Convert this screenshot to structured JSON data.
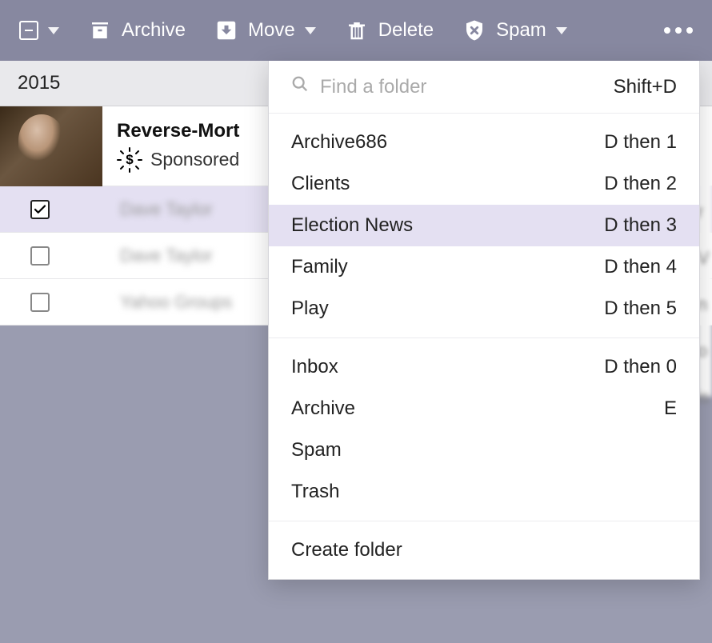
{
  "toolbar": {
    "archive_label": "Archive",
    "move_label": "Move",
    "delete_label": "Delete",
    "spam_label": "Spam"
  },
  "date_header": "2015",
  "sponsored": {
    "title": "Reverse-Mort",
    "label": "Sponsored"
  },
  "emails": [
    {
      "sender": "Dave Taylor",
      "checked": true
    },
    {
      "sender": "Dave Taylor",
      "checked": false
    },
    {
      "sender": "Yahoo Groups",
      "checked": false
    }
  ],
  "dropdown": {
    "search_placeholder": "Find a folder",
    "search_shortcut": "Shift+D",
    "folders": [
      {
        "name": "Archive686",
        "shortcut": "D then 1",
        "highlighted": false
      },
      {
        "name": "Clients",
        "shortcut": "D then 2",
        "highlighted": false
      },
      {
        "name": "Election News",
        "shortcut": "D then 3",
        "highlighted": true
      },
      {
        "name": "Family",
        "shortcut": "D then 4",
        "highlighted": false
      },
      {
        "name": "Play",
        "shortcut": "D then 5",
        "highlighted": false
      }
    ],
    "system_folders": [
      {
        "name": "Inbox",
        "shortcut": "D then 0"
      },
      {
        "name": "Archive",
        "shortcut": "E"
      },
      {
        "name": "Spam",
        "shortcut": ""
      },
      {
        "name": "Trash",
        "shortcut": ""
      }
    ],
    "create_folder_label": "Create folder"
  }
}
